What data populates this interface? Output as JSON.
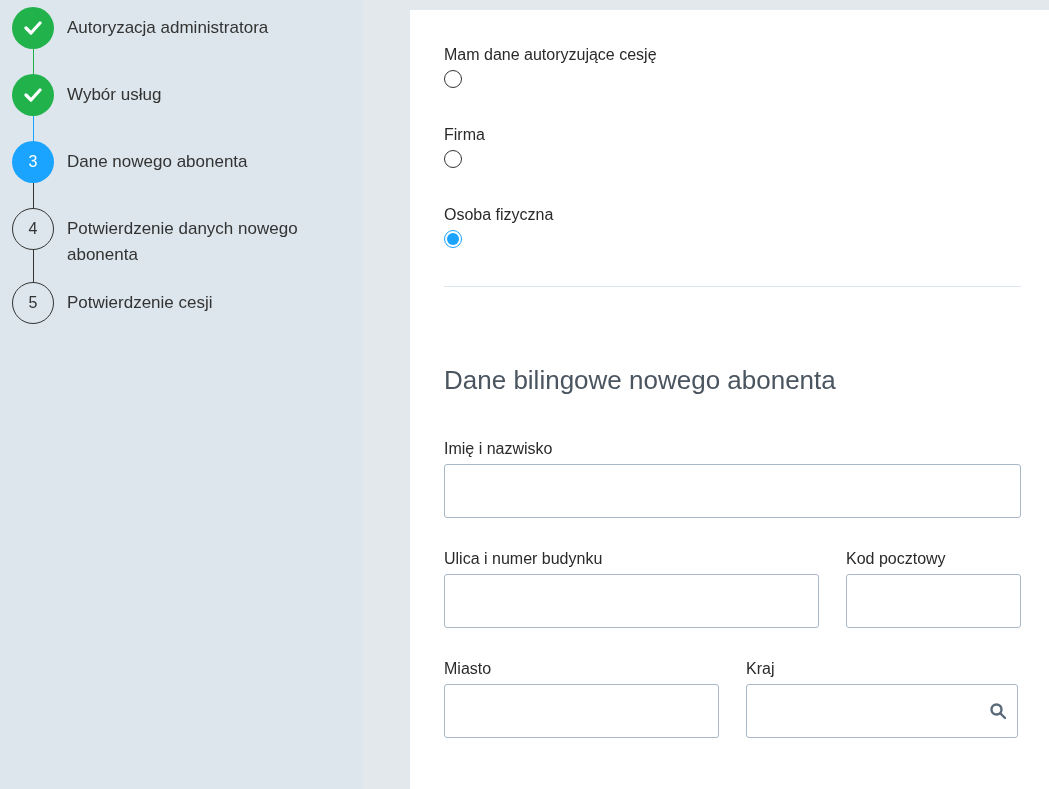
{
  "steps": [
    {
      "label": "Autoryzacja administratora",
      "kind": "done"
    },
    {
      "label": "Wybór usług",
      "kind": "done"
    },
    {
      "label": "Dane nowego abonenta",
      "kind": "current",
      "number": "3"
    },
    {
      "label": "Potwierdzenie danych nowego abonenta",
      "kind": "pending",
      "number": "4"
    },
    {
      "label": "Potwierdzenie cesji",
      "kind": "pending",
      "number": "5"
    }
  ],
  "options": [
    {
      "label": "Mam dane autoryzujące cesję",
      "selected": false
    },
    {
      "label": "Firma",
      "selected": false
    },
    {
      "label": "Osoba fizyczna",
      "selected": true
    }
  ],
  "section_title": "Dane bilingowe nowego abonenta",
  "field_rows": [
    [
      {
        "label": "Imię i nazwisko",
        "kind": "text"
      }
    ],
    [
      {
        "label": "Ulica i numer budynku",
        "kind": "text"
      },
      {
        "label": "Kod pocztowy",
        "kind": "text"
      }
    ],
    [
      {
        "label": "Miasto",
        "kind": "text"
      },
      {
        "label": "Kraj",
        "kind": "search"
      }
    ]
  ]
}
